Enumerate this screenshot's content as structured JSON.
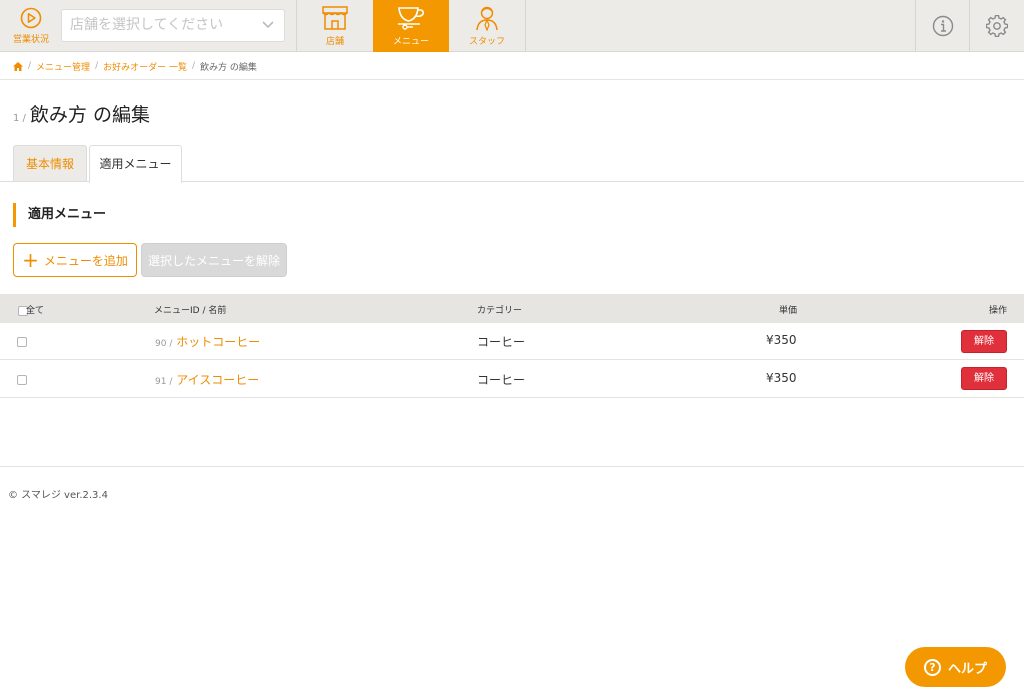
{
  "topbar": {
    "status_label": "営業状況",
    "store_placeholder": "店舗を選択してください",
    "tabs": [
      {
        "label": "店舗",
        "icon": "store-icon"
      },
      {
        "label": "メニュー",
        "icon": "cup-icon",
        "active": true
      },
      {
        "label": "スタッフ",
        "icon": "staff-icon"
      }
    ],
    "right_icons": [
      "info-icon",
      "gear-icon"
    ]
  },
  "breadcrumb": {
    "items": [
      "メニュー管理",
      "お好みオーダー 一覧"
    ],
    "current": "飲み方 の編集"
  },
  "page": {
    "number": "1 /",
    "title": "飲み方 の編集"
  },
  "tabs": {
    "basic": "基本情報",
    "menus": "適用メニュー"
  },
  "section": {
    "title": "適用メニュー",
    "add_button": "メニューを追加",
    "remove_selected_button": "選択したメニューを解除"
  },
  "table": {
    "headers": {
      "all": "全て",
      "id_name": "メニューID / 名前",
      "category": "カテゴリー",
      "price": "単価",
      "action": "操作"
    },
    "rows": [
      {
        "id": "90 /",
        "name": "ホットコーヒー",
        "category": "コーヒー",
        "price": "¥350",
        "action": "解除"
      },
      {
        "id": "91 /",
        "name": "アイスコーヒー",
        "category": "コーヒー",
        "price": "¥350",
        "action": "解除"
      }
    ]
  },
  "footer": {
    "copyright": "© スマレジ ver.2.3.4"
  },
  "help": {
    "label": "ヘルプ"
  },
  "colors": {
    "accent": "#f39800",
    "danger": "#e0303c"
  }
}
